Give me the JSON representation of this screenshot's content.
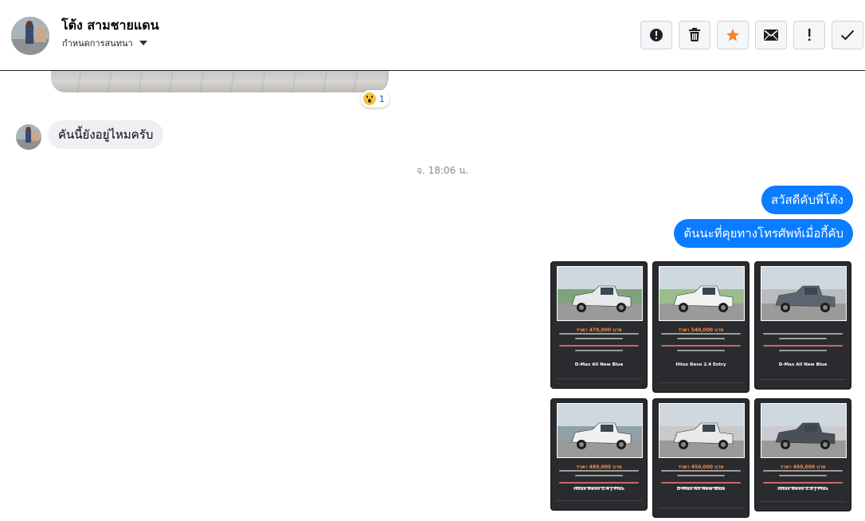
{
  "header": {
    "name": "โต้ง สามชายแดน",
    "subtitle": "กำหนดการสนทนา",
    "actions": [
      {
        "id": "report",
        "icon": "alert-circle-icon"
      },
      {
        "id": "delete",
        "icon": "trash-icon"
      },
      {
        "id": "star",
        "icon": "star-icon"
      },
      {
        "id": "mail",
        "icon": "envelope-icon"
      },
      {
        "id": "important",
        "icon": "exclamation-icon"
      },
      {
        "id": "done",
        "icon": "check-icon"
      }
    ]
  },
  "reaction": {
    "emoji": "wow-emoji",
    "count": "1"
  },
  "messages": {
    "incoming_1": "คันนี้ยังอยู่ไหมครับ",
    "timestamp": "จ. 18:06 น.",
    "outgoing_1": "สวัสดีคับพี่โต้ง",
    "outgoing_2": "ต้นนะที่คุยทางโทรศัพท์เมื่อกี้คับ"
  },
  "listings": [
    {
      "price": "ราคา 479,000 บาท",
      "model": "D-Max All New Blue",
      "car_color": "#e6e8ea",
      "bg": "#7fa37a"
    },
    {
      "price": "ราคา 540,000 บาท",
      "model": "Hilux Revo 2.4 Entry",
      "car_color": "#f2f2f2",
      "bg": "#9bbd8c"
    },
    {
      "price": "",
      "model": "D-Max All New Blue",
      "car_color": "#5d6670",
      "bg": "#b9bcbf"
    },
    {
      "price": "ราคา 489,000 บาท",
      "model": "Hilux Revo 2.4 J Plus",
      "car_color": "#f0f0f0",
      "bg": "#8fa0a8"
    },
    {
      "price": "ราคา 450,000 บาท",
      "model": "D-Max All New Blue",
      "car_color": "#e9e9e9",
      "bg": "#c7c9cb"
    },
    {
      "price": "ราคา 499,000 บาท",
      "model": "Hilux Revo 2.8 J Plus",
      "car_color": "#4a5058",
      "bg": "#c9cbce"
    }
  ]
}
